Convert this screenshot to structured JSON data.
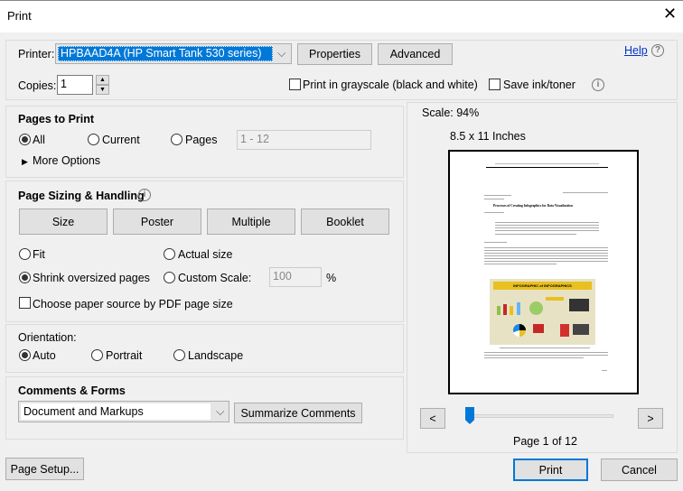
{
  "window": {
    "title": "Print",
    "close_icon": "close-icon"
  },
  "printer": {
    "label": "Printer:",
    "selected": "HPBAAD4A (HP Smart Tank 530 series)",
    "properties": "Properties",
    "advanced": "Advanced",
    "help": "Help",
    "copies_label": "Copies:",
    "copies": "1",
    "grayscale": "Print in grayscale (black and white)",
    "grayscale_checked": false,
    "save_ink": "Save ink/toner",
    "save_ink_checked": false
  },
  "pages": {
    "title": "Pages to Print",
    "all": "All",
    "current": "Current",
    "pages": "Pages",
    "range": "1 - 12",
    "more": "More Options",
    "selected": "All"
  },
  "sizing": {
    "title": "Page Sizing & Handling",
    "tabs": [
      "Size",
      "Poster",
      "Multiple",
      "Booklet"
    ],
    "fit": "Fit",
    "actual": "Actual size",
    "shrink": "Shrink oversized pages",
    "custom": "Custom Scale:",
    "scale_value": "100",
    "percent": "%",
    "paper_source": "Choose paper source by PDF page size",
    "selected": "Shrink oversized pages"
  },
  "orientation": {
    "title": "Orientation:",
    "auto": "Auto",
    "portrait": "Portrait",
    "landscape": "Landscape",
    "selected": "Auto"
  },
  "comments": {
    "title": "Comments & Forms",
    "selected": "Document and Markups",
    "summarize": "Summarize Comments"
  },
  "preview": {
    "scale": "Scale:  94%",
    "paper": "8.5 x 11 Inches",
    "doc_title": "Processes of Creating Infographics for Data Visualization",
    "infographic_title": "INFOGRAPHIC of INFOGRAPHICS",
    "page_status": "Page 1 of 12",
    "current_page": 1,
    "total_pages": 12,
    "prev": "<",
    "next": ">"
  },
  "footer": {
    "page_setup": "Page Setup...",
    "print": "Print",
    "cancel": "Cancel"
  },
  "colors": {
    "accent": "#0078d7",
    "selection": "#0078d7"
  }
}
